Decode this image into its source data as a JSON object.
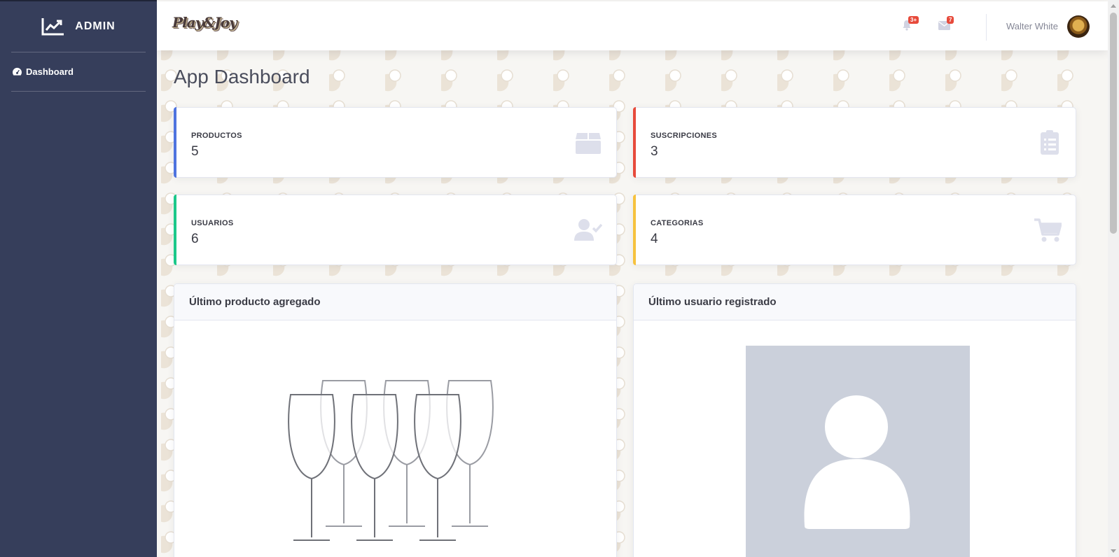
{
  "sidebar": {
    "brand_label": "ADMIN",
    "brand_icon": "chart-line-icon",
    "items": [
      {
        "label": "Dashboard",
        "icon": "tachometer-icon"
      }
    ]
  },
  "topbar": {
    "logo_text": "Play&Joy",
    "alerts_badge": "3+",
    "messages_badge": "7",
    "user_name": "Walter White"
  },
  "page": {
    "title": "App Dashboard"
  },
  "stats": [
    {
      "label": "PRODUCTOS",
      "value": "5",
      "color": "#4e73df",
      "icon": "box-icon"
    },
    {
      "label": "SUSCRIPCIONES",
      "value": "3",
      "color": "#e74a3b",
      "icon": "clipboard-list-icon"
    },
    {
      "label": "USUARIOS",
      "value": "6",
      "color": "#1cc88a",
      "icon": "user-check-icon"
    },
    {
      "label": "CATEGORIAS",
      "value": "4",
      "color": "#f6c23e",
      "icon": "shopping-cart-icon"
    }
  ],
  "panels": {
    "last_product_title": "Último producto agregado",
    "last_user_title": "Último usuario registrado"
  },
  "colors": {
    "sidebar_bg": "#363e5b",
    "stat_icon": "#dddfeb"
  }
}
